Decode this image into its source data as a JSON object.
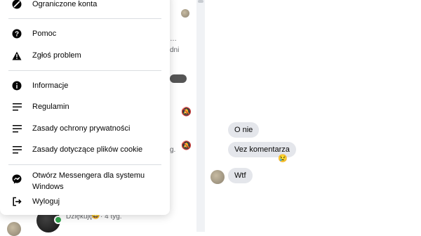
{
  "menu": {
    "items": [
      {
        "label": "Ograniczone konta",
        "icon": "restricted-icon"
      },
      {
        "label": "Pomoc",
        "icon": "help-icon"
      },
      {
        "label": "Zgłoś problem",
        "icon": "warning-icon"
      },
      {
        "label": "Informacje",
        "icon": "info-icon"
      },
      {
        "label": "Regulamin",
        "icon": "lines-icon"
      },
      {
        "label": "Zasady ochrony prywatności",
        "icon": "lines-icon"
      },
      {
        "label": "Zasady dotyczące plików cookie",
        "icon": "lines-icon"
      },
      {
        "label": "Otwórz Messengera dla systemu Windows",
        "icon": "messenger-icon"
      },
      {
        "label": "Wyloguj",
        "icon": "logout-icon"
      }
    ]
  },
  "background_list": {
    "preview_text": "Dziękuję",
    "preview_time": "· 4 tyg."
  },
  "chat": {
    "messages": [
      {
        "text": "O nie"
      },
      {
        "text": "Vez komentarza"
      },
      {
        "text": "Wtf"
      }
    ],
    "reaction": "😢"
  }
}
